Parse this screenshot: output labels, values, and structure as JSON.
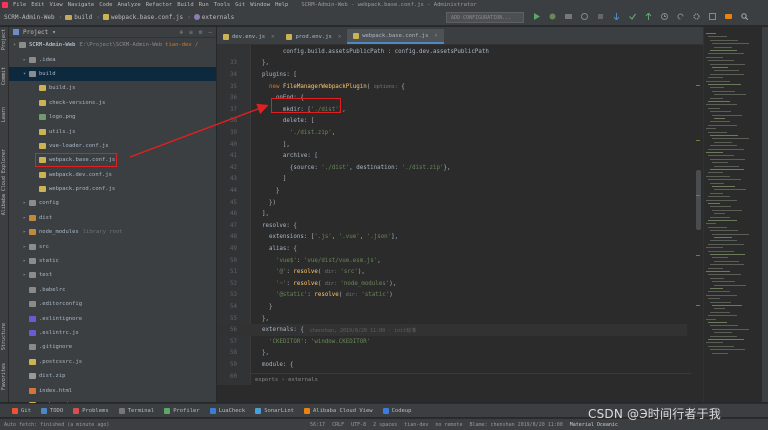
{
  "menu": {
    "items": [
      "File",
      "Edit",
      "View",
      "Navigate",
      "Code",
      "Analyze",
      "Refactor",
      "Build",
      "Run",
      "Tools",
      "Git",
      "Window",
      "Help"
    ],
    "window_title": "SCRM-Admin-Web - webpack.base.conf.js - Administrator"
  },
  "nav": {
    "crumbs": [
      "SCRM-Admin-Web",
      "build",
      "webpack.base.conf.js",
      "externals"
    ],
    "run_config": "ADD CONFIGURATION..."
  },
  "left_strip": {
    "labels": [
      "Project",
      "Commit",
      "Learn",
      "Alibaba Cloud Explorer",
      "Structure",
      "Favorites"
    ]
  },
  "project": {
    "header": "Project",
    "rows": [
      {
        "name": "SCRM-Admin-Web",
        "path": "E:\\Project\\SCRM-Admin-Web",
        "branch": "tian-dev /",
        "kind": "root",
        "depth": 0,
        "arrow": "▾"
      },
      {
        "name": ".idea",
        "kind": "folder",
        "depth": 1,
        "arrow": "▸"
      },
      {
        "name": "build",
        "kind": "folder",
        "depth": 1,
        "arrow": "▾",
        "selected": true
      },
      {
        "name": "build.js",
        "kind": "js",
        "depth": 2
      },
      {
        "name": "check-versions.js",
        "kind": "js",
        "depth": 2
      },
      {
        "name": "logo.png",
        "kind": "img",
        "depth": 2
      },
      {
        "name": "utils.js",
        "kind": "js",
        "depth": 2
      },
      {
        "name": "vue-loader.conf.js",
        "kind": "js",
        "depth": 2
      },
      {
        "name": "webpack.base.conf.js",
        "kind": "js",
        "depth": 2,
        "boxed": true
      },
      {
        "name": "webpack.dev.conf.js",
        "kind": "js",
        "depth": 2
      },
      {
        "name": "webpack.prod.conf.js",
        "kind": "js",
        "depth": 2
      },
      {
        "name": "config",
        "kind": "folder",
        "depth": 1,
        "arrow": "▸"
      },
      {
        "name": "dist",
        "kind": "folder-orange",
        "depth": 1,
        "arrow": "▸"
      },
      {
        "name": "node_modules",
        "dim": "library root",
        "kind": "folder-orange",
        "depth": 1,
        "arrow": "▸"
      },
      {
        "name": "src",
        "kind": "folder",
        "depth": 1,
        "arrow": "▸"
      },
      {
        "name": "static",
        "kind": "folder",
        "depth": 1,
        "arrow": "▸"
      },
      {
        "name": "test",
        "kind": "folder",
        "depth": 1,
        "arrow": "▸"
      },
      {
        "name": ".babelrc",
        "kind": "cfg",
        "depth": 1
      },
      {
        "name": ".editorconfig",
        "kind": "cfg",
        "depth": 1
      },
      {
        "name": ".eslintignore",
        "kind": "eslint",
        "depth": 1
      },
      {
        "name": ".eslintrc.js",
        "kind": "eslint",
        "depth": 1
      },
      {
        "name": ".gitignore",
        "kind": "cfg",
        "depth": 1
      },
      {
        "name": ".postcssrc.js",
        "kind": "js",
        "depth": 1
      },
      {
        "name": "dist.zip",
        "kind": "zip",
        "depth": 1
      },
      {
        "name": "index.html",
        "kind": "html",
        "depth": 1
      },
      {
        "name": "package.json",
        "kind": "json",
        "depth": 1
      }
    ]
  },
  "tabs": [
    {
      "label": "dev.env.js",
      "active": false
    },
    {
      "label": "prod.env.js",
      "active": false
    },
    {
      "label": "webpack.base.conf.js",
      "active": true
    }
  ],
  "code_lines": [
    {
      "n": "",
      "text": "        config.build.assetsPublicPath : config.dev.assetsPublicPath"
    },
    {
      "n": "33",
      "text": "  },"
    },
    {
      "n": "34",
      "text": "  plugins: ["
    },
    {
      "n": "35",
      "text": "    new FileManagerWebpackPlugin( options: {"
    },
    {
      "n": "36",
      "text": "      onEnd: {"
    },
    {
      "n": "37",
      "text": "        mkdir: ['./dist'],"
    },
    {
      "n": "38",
      "text": "        delete: ["
    },
    {
      "n": "39",
      "text": "          './dist.zip',"
    },
    {
      "n": "40",
      "text": "        ],"
    },
    {
      "n": "41",
      "text": "        archive: ["
    },
    {
      "n": "42",
      "text": "          {source: './dist', destination: './dist.zip'},"
    },
    {
      "n": "43",
      "text": "        ]"
    },
    {
      "n": "44",
      "text": "      }"
    },
    {
      "n": "45",
      "text": "    })"
    },
    {
      "n": "46",
      "text": "  ],"
    },
    {
      "n": "47",
      "text": "  resolve: {"
    },
    {
      "n": "48",
      "text": "    extensions: ['.js', '.vue', '.json'],"
    },
    {
      "n": "49",
      "text": "    alias: {"
    },
    {
      "n": "50",
      "text": "      'vue$': 'vue/dist/vue.esm.js',"
    },
    {
      "n": "51",
      "text": "      '@': resolve( dir: 'src'),"
    },
    {
      "n": "52",
      "text": "      '~': resolve( dir: 'node_modules'),"
    },
    {
      "n": "53",
      "text": "      '@static': resolve( dir: 'static')"
    },
    {
      "n": "54",
      "text": "    }"
    },
    {
      "n": "55",
      "text": "  },"
    },
    {
      "n": "56",
      "text": "  externals: {"
    },
    {
      "n": "57",
      "text": "    'CKEDITOR': 'window.CKEDITOR'"
    },
    {
      "n": "58",
      "text": "  },"
    },
    {
      "n": "59",
      "text": "  module: {"
    },
    {
      "n": "60",
      "text": "    rules: ["
    },
    {
      "n": "61",
      "text": "      // ...(config.dev.useEslint ? [createLintingRule()] : []),"
    },
    {
      "n": "62",
      "text": "      {"
    },
    {
      "n": "63",
      "text": "        test: /\\.vue$/,"
    },
    {
      "n": "64",
      "text": "        loader: 'vue-loader',"
    }
  ],
  "blame_hint": "chenshan, 2019/8/20 11:00 · init标准",
  "editor_breadcrumb": "exports › externals",
  "tool_windows": [
    "Git",
    "TODO",
    "Problems",
    "Terminal",
    "Profiler",
    "LuaCheck",
    "SonarLint",
    "Alibaba Cloud View",
    "Codeup"
  ],
  "status": {
    "left": "Auto fetch: finished (a minute ago)",
    "position": "56:17",
    "line_sep": "CRLF",
    "encoding": "UTF-8",
    "indent": "2 spaces",
    "branch": "tian-dev",
    "remote": "no remote",
    "blame": "Blame: chenshan 2019/8/20 11:00",
    "theme": "Material Oceanic"
  },
  "watermark": "CSDN @Э时间行者于我",
  "colors": {
    "annotation_red": "#e02020",
    "accent_blue": "#4a88c7",
    "string_green": "#6a8759",
    "keyword_orange": "#cc7832"
  }
}
